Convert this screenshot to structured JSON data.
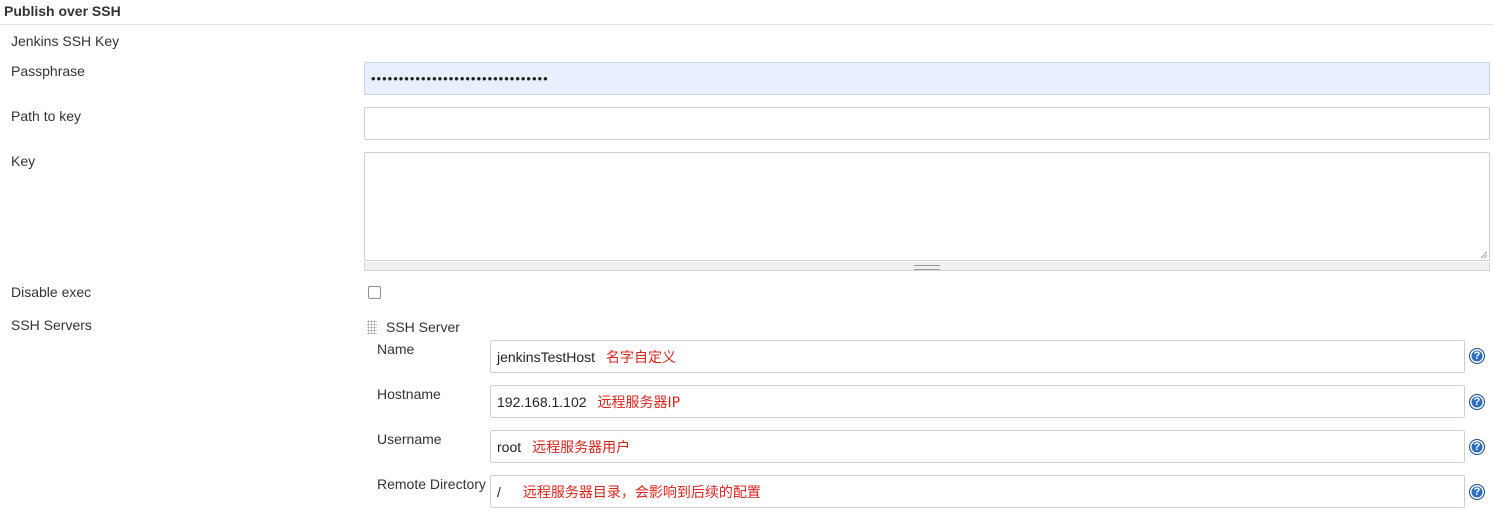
{
  "section": {
    "title": "Publish over SSH"
  },
  "fields": {
    "jenkins_ssh_key_label": "Jenkins SSH Key",
    "passphrase_label": "Passphrase",
    "passphrase_value": "••••••••••••••••••••••••••••••••",
    "path_to_key_label": "Path to key",
    "path_to_key_value": "",
    "key_label": "Key",
    "key_value": "",
    "disable_exec_label": "Disable exec",
    "disable_exec_checked": false,
    "ssh_servers_label": "SSH Servers"
  },
  "ssh_server": {
    "header": "SSH Server",
    "name_label": "Name",
    "name_value": "jenkinsTestHost",
    "name_annotation": "名字自定义",
    "hostname_label": "Hostname",
    "hostname_value": "192.168.1.102",
    "hostname_annotation": "远程服务器IP",
    "username_label": "Username",
    "username_value": "root",
    "username_annotation": "远程服务器用户",
    "remote_dir_label": "Remote Directory",
    "remote_dir_value": "/",
    "remote_dir_annotation": "远程服务器目录，会影响到后续的配置",
    "help_glyph": "?"
  },
  "icons": {
    "help": "help-icon",
    "drag": "drag-handle-icon",
    "resize": "resize-grip-icon"
  },
  "colors": {
    "annotation": "#d9251d",
    "help_icon": "#2c6ebd",
    "autofill_bg": "#e8f0fe"
  }
}
